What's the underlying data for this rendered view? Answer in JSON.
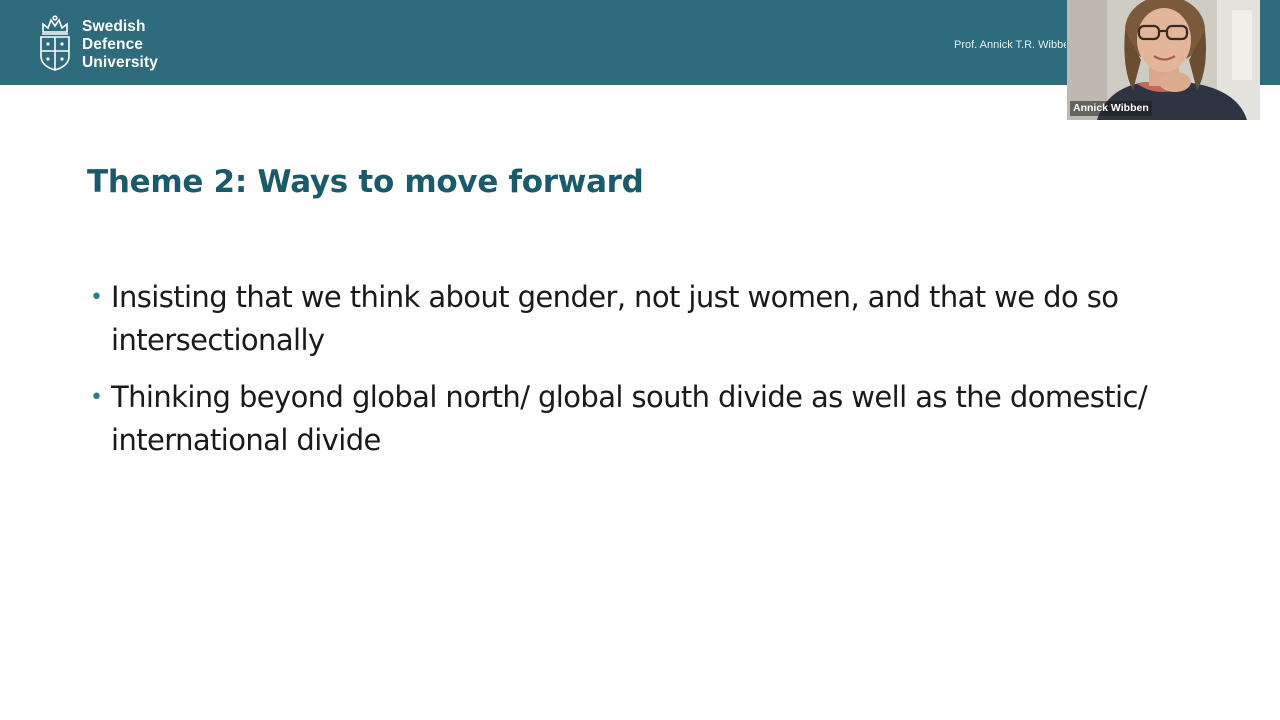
{
  "header": {
    "logo_lines": [
      "Swedish",
      "Defence",
      "University"
    ],
    "presenter_label": "Prof. Annick T.R. Wibben",
    "band_color": "#2e6b7d"
  },
  "webcam": {
    "participant_name": "Annick Wibben"
  },
  "slide": {
    "title": "Theme 2: Ways to move forward",
    "title_color": "#1b5a6b",
    "bullets": [
      {
        "text": "Insisting that we think about gender, not just women, and that we do so intersectionally"
      },
      {
        "text": "Thinking beyond global north/ global south divide as well as the domestic/ international divide"
      }
    ],
    "bullet_icon": "bullet-dot-icon"
  }
}
